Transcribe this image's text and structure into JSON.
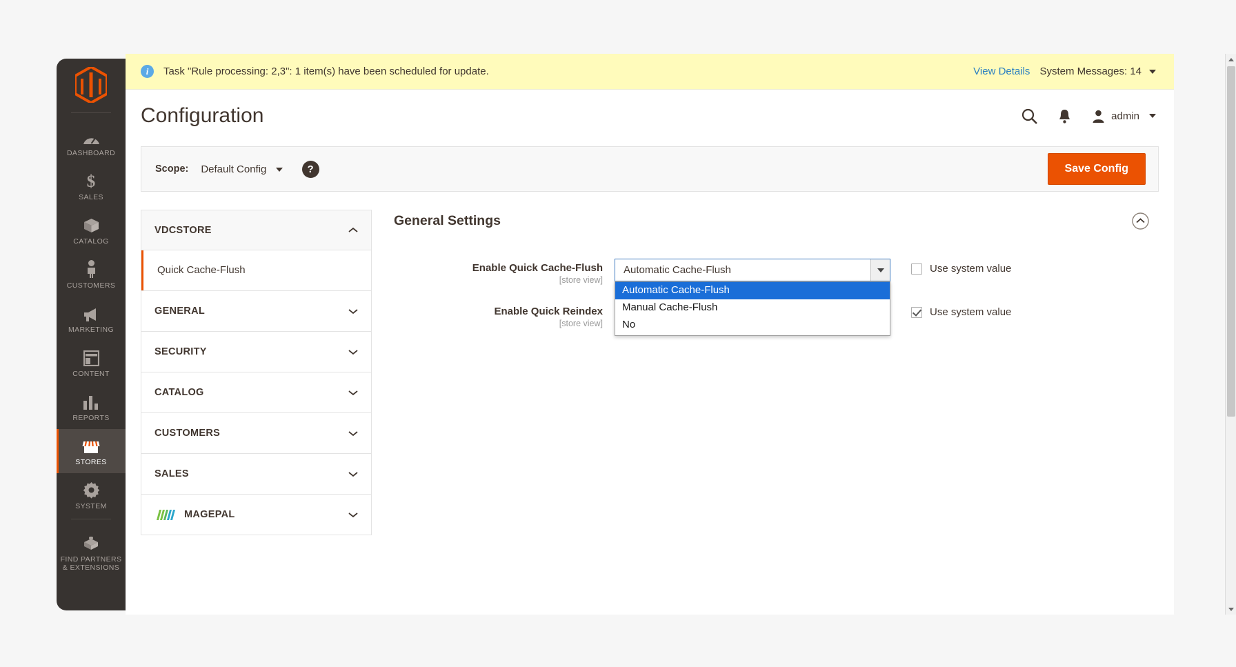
{
  "adminmenu": {
    "logo_alt": "magento-logo",
    "items": [
      {
        "label": "DASHBOARD",
        "icon": "dashboard-icon",
        "active": false
      },
      {
        "label": "SALES",
        "icon": "sales-dollar-icon",
        "active": false
      },
      {
        "label": "CATALOG",
        "icon": "catalog-box-icon",
        "active": false
      },
      {
        "label": "CUSTOMERS",
        "icon": "customers-person-icon",
        "active": false
      },
      {
        "label": "MARKETING",
        "icon": "marketing-megaphone-icon",
        "active": false
      },
      {
        "label": "CONTENT",
        "icon": "content-layout-icon",
        "active": false
      },
      {
        "label": "REPORTS",
        "icon": "reports-bars-icon",
        "active": false
      },
      {
        "label": "STORES",
        "icon": "stores-shop-icon",
        "active": true
      },
      {
        "label": "SYSTEM",
        "icon": "system-gear-icon",
        "active": false
      }
    ],
    "find_partners_line1": "FIND PARTNERS",
    "find_partners_line2": "& EXTENSIONS"
  },
  "message_bar": {
    "text": "Task \"Rule processing: 2,3\": 1 item(s) have been scheduled for update.",
    "view_details": "View Details",
    "system_messages": "System Messages: 14"
  },
  "header": {
    "title": "Configuration",
    "admin_user": "admin"
  },
  "scope_bar": {
    "label": "Scope:",
    "value": "Default Config",
    "help": "?",
    "save_label": "Save Config"
  },
  "config_nav": {
    "sections": [
      {
        "label": "VDCSTORE",
        "open": true,
        "has_logo": false
      },
      {
        "label": "GENERAL",
        "open": false,
        "has_logo": false
      },
      {
        "label": "SECURITY",
        "open": false,
        "has_logo": false
      },
      {
        "label": "CATALOG",
        "open": false,
        "has_logo": false
      },
      {
        "label": "CUSTOMERS",
        "open": false,
        "has_logo": false
      },
      {
        "label": "SALES",
        "open": false,
        "has_logo": false
      },
      {
        "label": "MAGEPAL",
        "open": false,
        "has_logo": true
      }
    ],
    "vdcstore_items": [
      {
        "label": "Quick Cache-Flush",
        "active": true
      }
    ]
  },
  "settings": {
    "section_title": "General Settings",
    "fields": [
      {
        "label": "Enable Quick Cache-Flush",
        "scope": "[store view]",
        "value": "Automatic Cache-Flush",
        "use_system_value": "Use system value",
        "use_system_checked": false,
        "dropdown_open": true,
        "options": [
          "Automatic Cache-Flush",
          "Manual Cache-Flush",
          "No"
        ],
        "selected_option": "Automatic Cache-Flush"
      },
      {
        "label": "Enable Quick Reindex",
        "scope": "[store view]",
        "use_system_value": "Use system value",
        "use_system_checked": true
      }
    ]
  },
  "colors": {
    "accent_orange": "#eb5202",
    "sidebar_dark": "#373330",
    "message_yellow": "#fffbbb",
    "link_blue": "#2a7fc1",
    "option_highlight": "#1a6ed8"
  }
}
